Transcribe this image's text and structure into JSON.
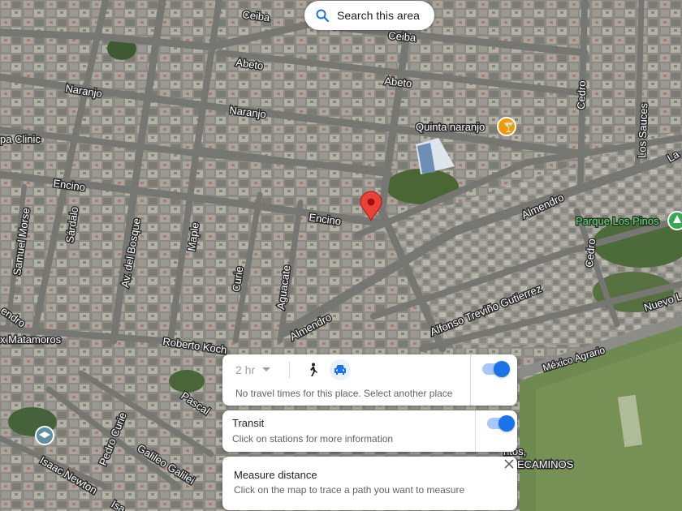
{
  "search": {
    "label": "Search this area"
  },
  "streets": [
    "Ceiba",
    "Ceiba",
    "Abeto",
    "Abeto",
    "Naranjo",
    "Naranjo",
    "Cedro",
    "Los Sauces",
    "Encino",
    "Encino",
    "Almendro",
    "Almendro",
    "Cedro",
    "Samuel Morse",
    "Sárdalo",
    "Av. del Bosque",
    "Maple",
    "Curie",
    "Aguacate",
    "Alfonso Treviño Gutierrez",
    "Nuevo L",
    "México Agrario",
    "Roberto Koch",
    "Pascal",
    "Pedro Curie",
    "Galileo Galilei",
    "Isaac Newton",
    "Isa",
    "La",
    "endro",
    "x Matamoros"
  ],
  "pois": {
    "quinta": "Quinta naranjo",
    "park": "Parque Los Pinos",
    "clinic": "pa Clinic",
    "bottom_right_a": "ntos,",
    "bottom_right_b": "ECAMINOS"
  },
  "travel_panel": {
    "time": "2 hr",
    "message": "No travel times for this place. Select another place",
    "toggle_on": true
  },
  "transit_panel": {
    "title": "Transit",
    "subtitle": "Click on stations for more information",
    "toggle_on": true
  },
  "measure_panel": {
    "title": "Measure distance",
    "subtitle": "Click on the map to trace a path you want to measure",
    "close_icon": "close-icon"
  },
  "colors": {
    "accent": "#1a73e8",
    "pin": "#ea4335",
    "poi_orange": "#f29900",
    "poi_green": "#34a853"
  }
}
